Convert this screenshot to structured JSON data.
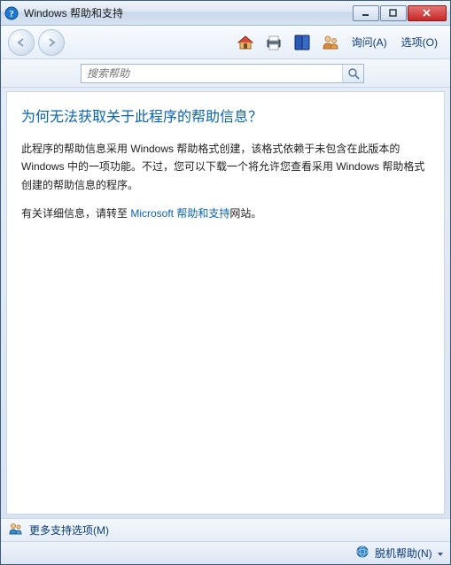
{
  "window": {
    "title": "Windows 帮助和支持"
  },
  "toolbar": {
    "ask_label": "询问(A)",
    "options_label": "选项(O)"
  },
  "search": {
    "placeholder": "搜索帮助"
  },
  "content": {
    "heading": "为何无法获取关于此程序的帮助信息？",
    "p1": "此程序的帮助信息采用 Windows 帮助格式创建，该格式依赖于未包含在此版本的 Windows 中的一项功能。不过，您可以下载一个将允许您查看采用 Windows 帮助格式创建的帮助信息的程序。",
    "p2_prefix": "有关详细信息，请转至 ",
    "p2_link": "Microsoft 帮助和支持",
    "p2_suffix": "网站。"
  },
  "footer": {
    "more_options": "更多支持选项(M)",
    "offline_help": "脱机帮助(N)"
  }
}
